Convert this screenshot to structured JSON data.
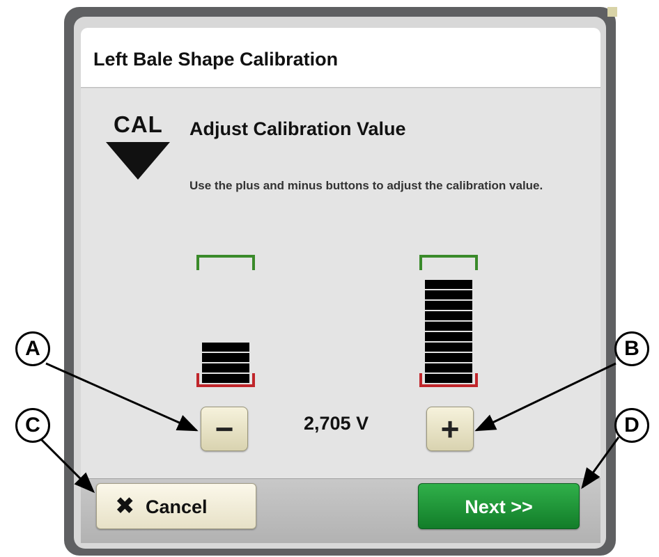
{
  "dialog": {
    "title": "Left Bale Shape Calibration",
    "cal_icon_label": "CAL",
    "step_title": "Adjust Calibration Value",
    "instructions": "Use the plus and minus buttons to adjust the calibration value."
  },
  "left_indicator": {
    "filled_segments": 4
  },
  "right_indicator": {
    "filled_segments": 10
  },
  "controls": {
    "minus_label": "−",
    "plus_label": "+",
    "value": "2,705 V"
  },
  "footer": {
    "cancel_icon": "✖",
    "cancel_label": "Cancel",
    "next_label": "Next >>"
  },
  "callouts": {
    "a": "A",
    "b": "B",
    "c": "C",
    "d": "D"
  },
  "colors": {
    "upper_limit": "#3a8a2a",
    "lower_limit": "#c0262b",
    "next_button": "#1f9a38"
  }
}
